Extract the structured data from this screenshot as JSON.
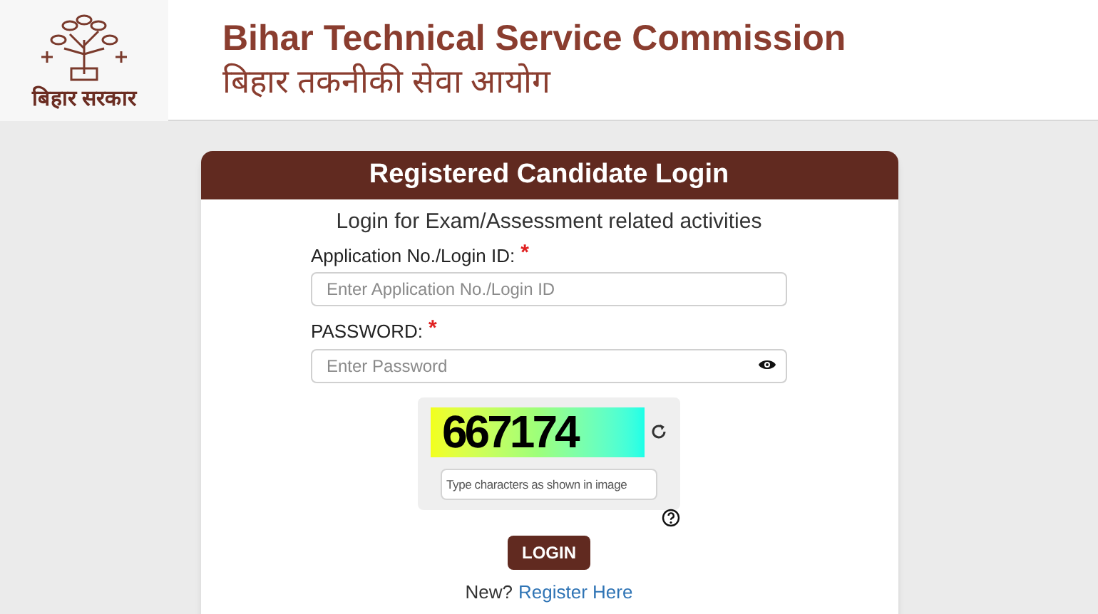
{
  "header": {
    "logo_caption": "बिहार सरकार",
    "title": "Bihar Technical Service Commission",
    "subtitle": "बिहार तकनीकी सेवा आयोग"
  },
  "login_card": {
    "title": "Registered Candidate Login",
    "subtitle": "Login for Exam/Assessment related activities",
    "fields": [
      {
        "label": "Application No./Login ID:",
        "required_mark": "*",
        "placeholder": "Enter Application No./Login ID",
        "kind": "text"
      },
      {
        "label": "PASSWORD:",
        "required_mark": "*",
        "placeholder": "Enter Password",
        "kind": "password"
      }
    ],
    "captcha": {
      "code": "667174",
      "placeholder": "Type characters as shown in image"
    },
    "login_button": "LOGIN",
    "register_prompt": "New?",
    "register_link": "Register Here"
  }
}
